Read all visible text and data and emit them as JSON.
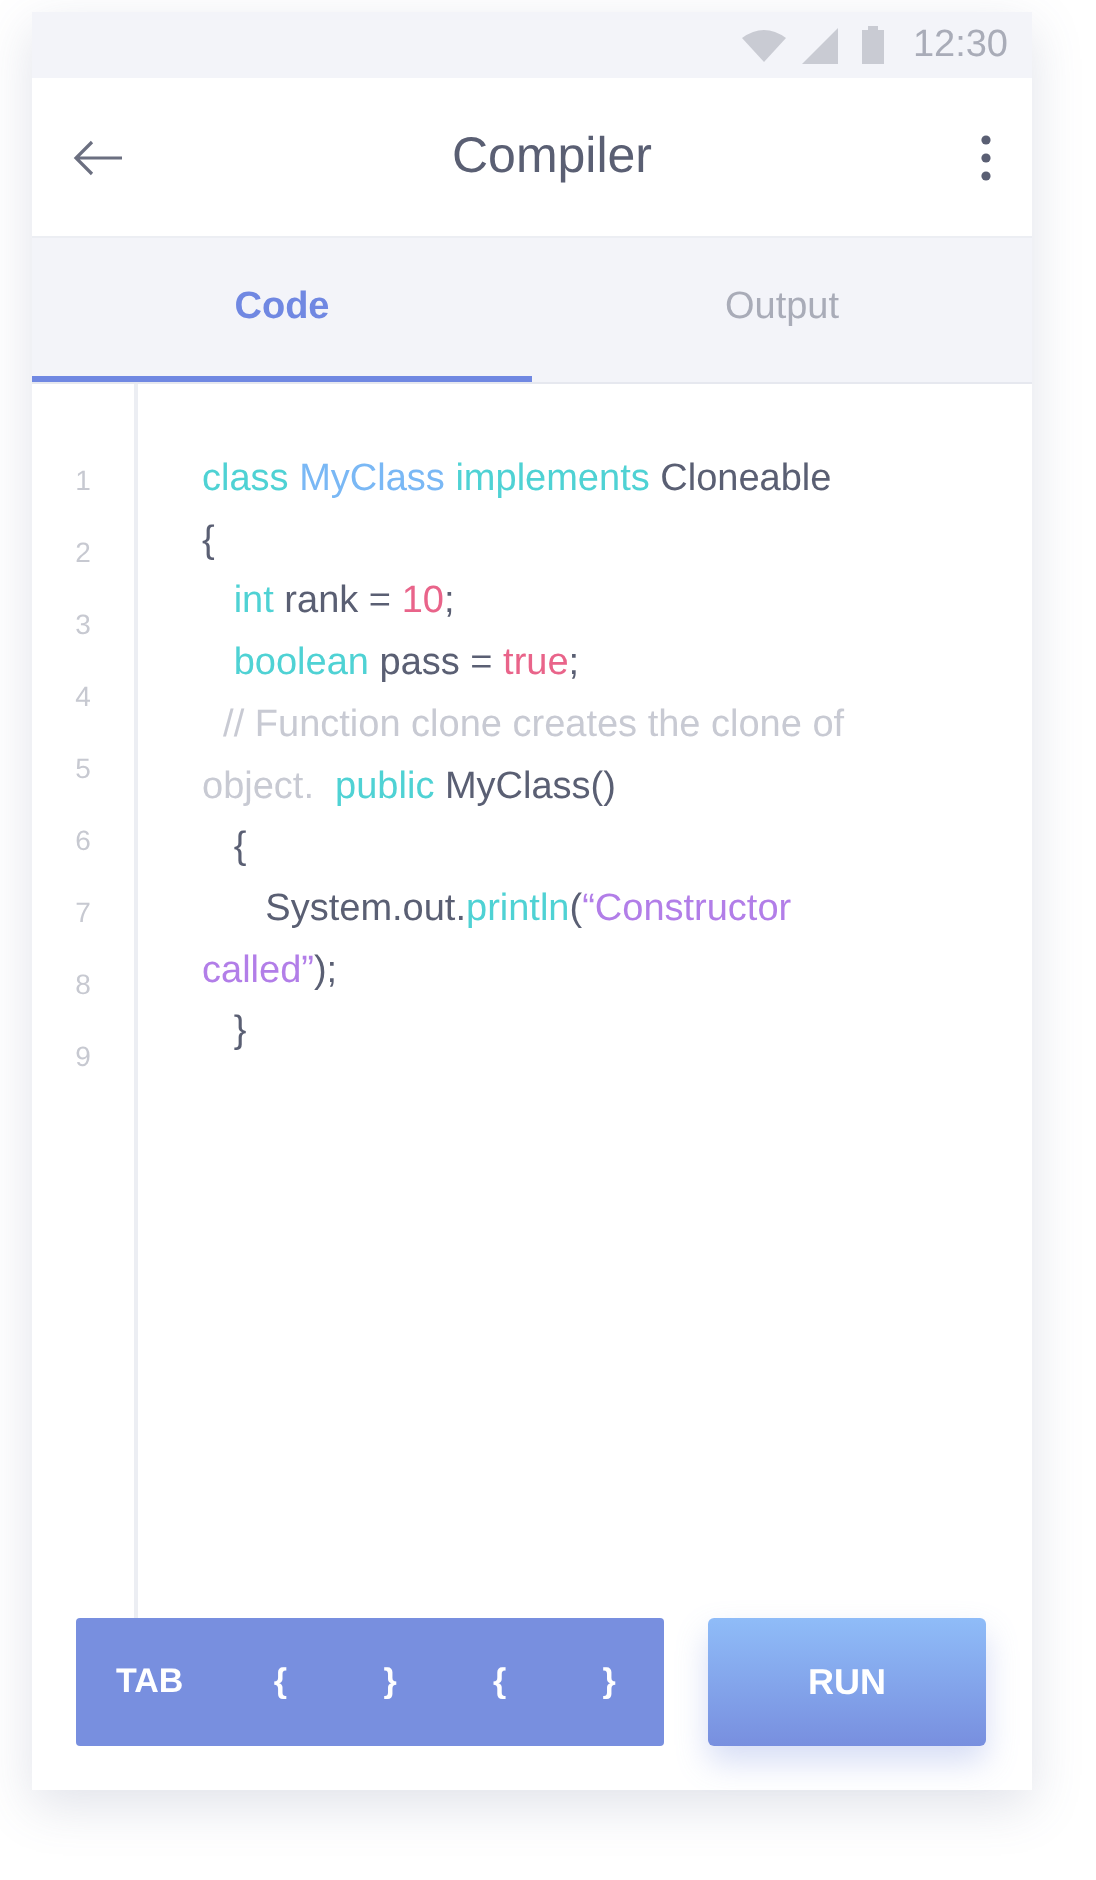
{
  "status_bar": {
    "time": "12:30"
  },
  "app_bar": {
    "title": "Compiler"
  },
  "tabs": [
    {
      "label": "Code",
      "selected": true
    },
    {
      "label": "Output",
      "selected": false
    }
  ],
  "editor": {
    "line_numbers": [
      "1",
      "2",
      "3",
      "4",
      "5",
      "6",
      "7",
      "8",
      "9"
    ],
    "lines": [
      [
        {
          "kind": "keyword",
          "text": "class "
        },
        {
          "kind": "type",
          "text": "MyClass "
        },
        {
          "kind": "keyword",
          "text": "implements "
        },
        {
          "kind": "plain",
          "text": "Cloneable"
        }
      ],
      [
        {
          "kind": "plain",
          "text": "{"
        }
      ],
      [
        {
          "kind": "keyword",
          "text": "   int"
        },
        {
          "kind": "plain",
          "text": " rank = "
        },
        {
          "kind": "literal",
          "text": "10"
        },
        {
          "kind": "plain",
          "text": ";"
        }
      ],
      [
        {
          "kind": "keyword",
          "text": "   boolean"
        },
        {
          "kind": "plain",
          "text": " pass = "
        },
        {
          "kind": "literal",
          "text": "true"
        },
        {
          "kind": "plain",
          "text": ";"
        }
      ],
      [
        {
          "kind": "comment",
          "text": "  // Function clone creates the clone of"
        }
      ],
      [
        {
          "kind": "comment",
          "text": "object.  "
        },
        {
          "kind": "keyword",
          "text": "public "
        },
        {
          "kind": "plain",
          "text": "MyClass()"
        }
      ],
      [
        {
          "kind": "plain",
          "text": "   {"
        }
      ],
      [
        {
          "kind": "plain",
          "text": "      System.out."
        },
        {
          "kind": "keyword",
          "text": "println"
        },
        {
          "kind": "plain",
          "text": "("
        },
        {
          "kind": "string",
          "text": "“Constructor"
        }
      ],
      [
        {
          "kind": "string",
          "text": "called”"
        },
        {
          "kind": "plain",
          "text": ");"
        }
      ],
      [
        {
          "kind": "plain",
          "text": "   }"
        }
      ]
    ]
  },
  "key_bar": {
    "keys": [
      "TAB",
      "{",
      "}",
      "{",
      "}"
    ]
  },
  "run_button": {
    "label": "RUN"
  }
}
